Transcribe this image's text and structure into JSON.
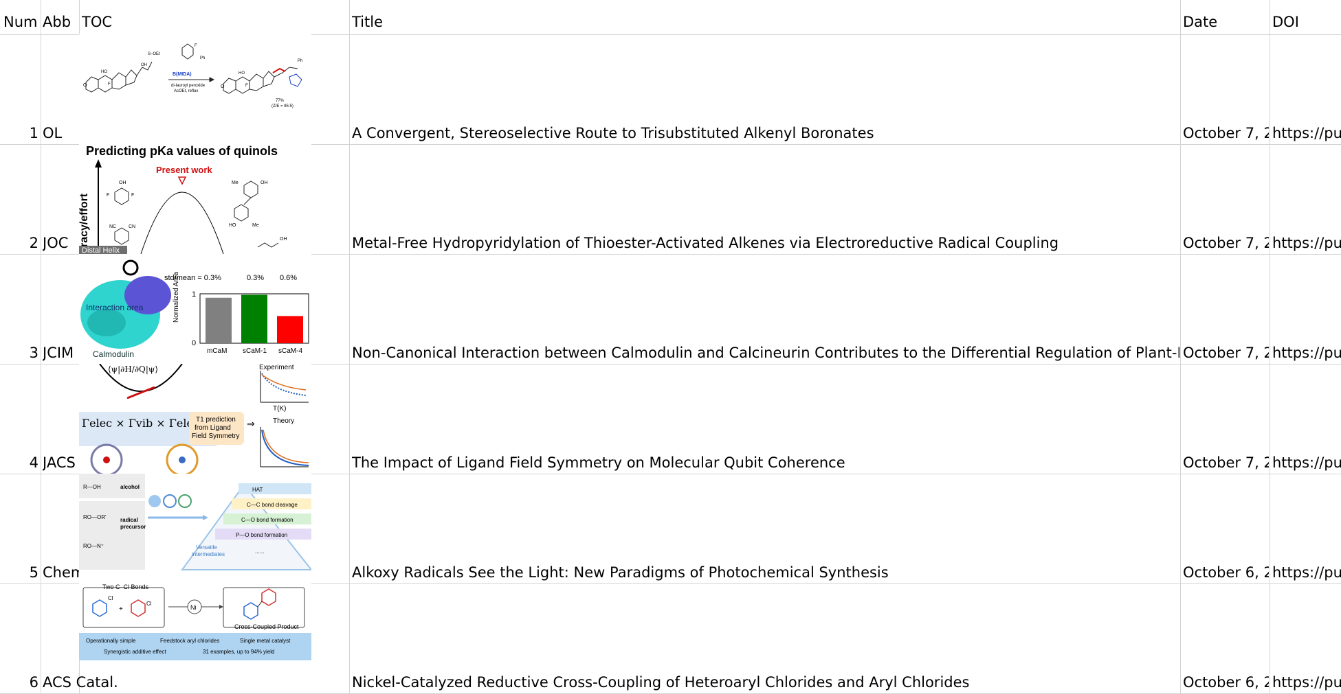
{
  "headers": {
    "num": "Num",
    "abb": "Abb",
    "toc": "TOC",
    "title": "Title",
    "date": "Date",
    "doi": "DOI"
  },
  "rows": [
    {
      "num": "1",
      "abb": "OL",
      "title": "A Convergent, Stereoselective Route to Trisubstituted Alkenyl Boronates",
      "date": "October 7, 2",
      "doi": "https://pu"
    },
    {
      "num": "2",
      "abb": "JOC",
      "title": "Metal-Free Hydropyridylation of Thioester-Activated Alkenes via Electroreductive Radical Coupling",
      "date": "October 7, 2",
      "doi": "https://pu"
    },
    {
      "num": "3",
      "abb": "JCIM",
      "title": "Non-Canonical Interaction between Calmodulin and Calcineurin Contributes to the Differential Regulation of Plant-Deriv",
      "date": "October 7, 2",
      "doi": "https://pu"
    },
    {
      "num": "4",
      "abb": "JACS",
      "title": "The Impact of Ligand Field Symmetry on Molecular Qubit Coherence",
      "date": "October 7, 2",
      "doi": "https://pu"
    },
    {
      "num": "5",
      "abb": "Chem Rev.",
      "title": "Alkoxy Radicals See the Light: New Paradigms of Photochemical Synthesis",
      "date": "October 6, 2",
      "doi": "https://pu"
    },
    {
      "num": "6",
      "abb": "ACS Catal.",
      "title": "Nickel-Catalyzed Reductive Cross-Coupling of Heteroaryl Chlorides and Aryl Chlorides",
      "date": "October 6, 2",
      "doi": "https://pu"
    }
  ],
  "toc1": {
    "reagent": "B(MIDA)",
    "cond1": "di-lauroyl peroxide",
    "cond2": "AcOEt, reflux",
    "yield": "77%",
    "ratio": "(Z/E = 95:5)"
  },
  "toc2": {
    "title": "Predicting pKa values of quinols",
    "present": "Present work",
    "axis": "racy/effort",
    "helix": "Distal Helix"
  },
  "toc3": {
    "std_label": "std/mean = 0.3%",
    "std2": "0.3%",
    "std3": "0.6%",
    "ylabel": "Normalized Area",
    "area_label": "Interaction area",
    "protein": "Calmodulin",
    "bars": [
      {
        "name": "mCaM",
        "value": 0.92,
        "color": "#808080"
      },
      {
        "name": "sCaM-1",
        "value": 0.98,
        "color": "#008000"
      },
      {
        "name": "sCaM-4",
        "value": 0.55,
        "color": "#ff0000"
      }
    ],
    "ticks": [
      "0",
      "1"
    ]
  },
  "toc4": {
    "experiment": "Experiment",
    "tk": "T(K)",
    "theory": "Theory",
    "pred1": "T1 prediction",
    "pred2": "from Ligand",
    "pred3": "Field Symmetry"
  },
  "toc5": {
    "alcohol": "alcohol",
    "radical": "radical",
    "precursor": "precursor",
    "hat": "HAT",
    "cc": "C—C bond cleavage",
    "co": "C—O bond formation",
    "po": "P—O bond formation",
    "dots": "......",
    "versatile": "Versatile",
    "intermediates": "intermediates"
  },
  "toc6": {
    "twocl": "Two C–Cl Bonds",
    "product": "Cross-Coupled Product",
    "ni": "Ni",
    "feat1": "Operationally simple",
    "feat2": "Feedstock aryl chlorides",
    "feat3": "Single metal catalyst",
    "feat4": "Synergistic additive effect",
    "feat5": "31 examples, up to 94% yield"
  }
}
